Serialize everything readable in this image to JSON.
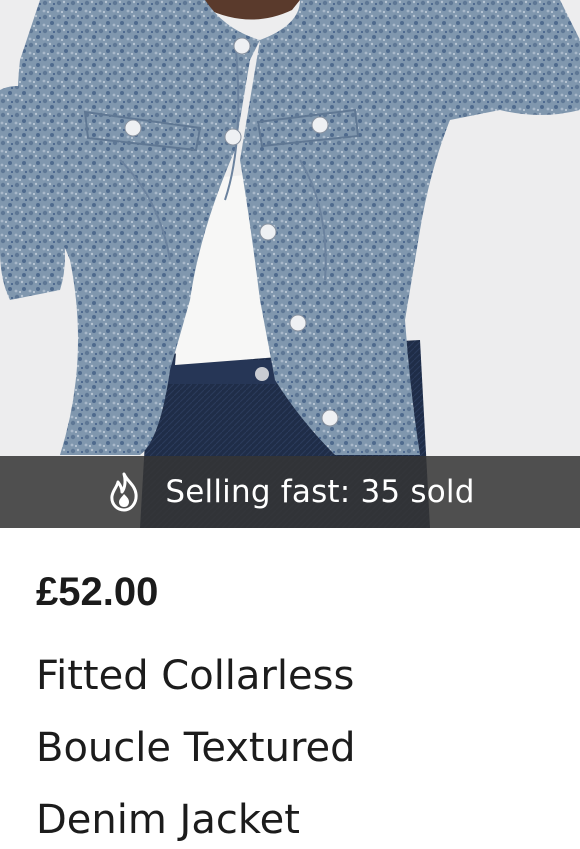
{
  "product": {
    "image_alt": "Model wearing a blue boucle textured denim jacket over a white top and dark jeans",
    "banner": {
      "icon": "fire-icon",
      "text": "Selling fast: 35 sold"
    },
    "price": "£52.00",
    "title_lines": [
      "Fitted Collarless",
      "Boucle Textured",
      "Denim Jacket"
    ]
  },
  "colors": {
    "banner_bg": "#343434",
    "jacket": "#7f95ad",
    "text": "#1c1c1c"
  }
}
